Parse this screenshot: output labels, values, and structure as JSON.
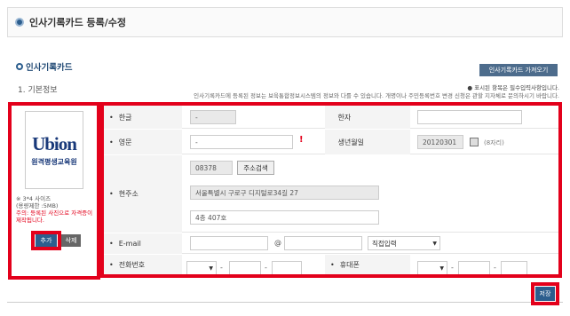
{
  "page": {
    "title": "인사기록카드 등록/수정"
  },
  "section": {
    "title": "인사기록카드",
    "import_button": "인사기록카드 가져오기",
    "subtitle": "1. 기본정보"
  },
  "notice": {
    "required": "표시된 항목은 필수입력사항입니다.",
    "info": "인사기록카드에 등록된 정보는 보육통합정보시스템의 정보와 다를 수 있습니다. 개명이나 주민등록번호 변경 신청은 관할 지자체로 문의하시기 바랍니다."
  },
  "photo": {
    "logo_text": "Ubion",
    "logo_sub": "원격평생교육원",
    "size_note": "3*4 사이즈",
    "capacity_note": "(용량제한 :5MB)",
    "warning": "주의: 등록된 사진으로 자격증이 제작됩니다.",
    "add_button": "추가",
    "delete_button": "삭제"
  },
  "form": {
    "name_kr": {
      "label": "한글",
      "value": "-"
    },
    "name_hanja": {
      "label": "한자",
      "value": ""
    },
    "name_en": {
      "label": "영문",
      "value": "-",
      "required_mark": "!"
    },
    "birth": {
      "label": "생년월일",
      "value": "20120301",
      "hint": "(8자리)"
    },
    "address": {
      "label": "현주소",
      "zipcode": "08378",
      "search_button": "주소검색",
      "address1": "서울특별시 구로구 디지털로34길 27",
      "address2": "4층 407호"
    },
    "email": {
      "label": "E-mail",
      "at": "@",
      "domain_select": "직접입력"
    },
    "phone": {
      "label": "전화번호"
    },
    "mobile": {
      "label": "휴대폰"
    }
  },
  "save_button": "저장"
}
